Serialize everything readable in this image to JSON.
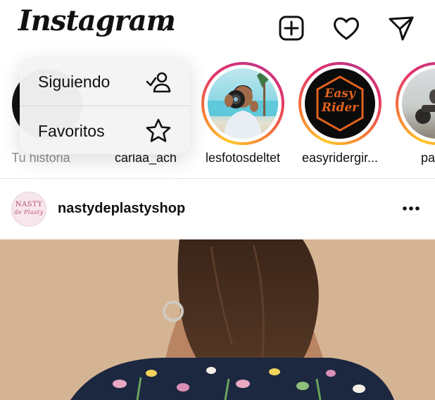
{
  "header": {
    "logo_text": "Instagram",
    "icons": [
      "chevron-down-icon",
      "new-post-icon",
      "heart-icon",
      "direct-message-icon"
    ]
  },
  "stories": [
    {
      "label": "Tu historia",
      "own": true
    },
    {
      "label": "carlaa_ach"
    },
    {
      "label": "lesfotosdeltet"
    },
    {
      "label": "easyridergir..."
    },
    {
      "label": "pau_r"
    }
  ],
  "dropdown": {
    "items": [
      {
        "label": "Siguiendo",
        "icon": "following-icon"
      },
      {
        "label": "Favoritos",
        "icon": "star-icon"
      }
    ]
  },
  "post": {
    "username": "nastydeplastyshop",
    "avatar_text": "NASTY",
    "avatar_subtext": "de Plasty",
    "more_icon": "more-options-icon"
  },
  "story_badge": {
    "easy_rider": {
      "line1": "Easy",
      "line2": "Rider"
    }
  },
  "colors": {
    "ring_gradient": [
      "#fdc829",
      "#f77737",
      "#e1306c",
      "#c13584"
    ],
    "easy_rider_orange": "#e2621e",
    "post_bg": "#d5b494"
  }
}
